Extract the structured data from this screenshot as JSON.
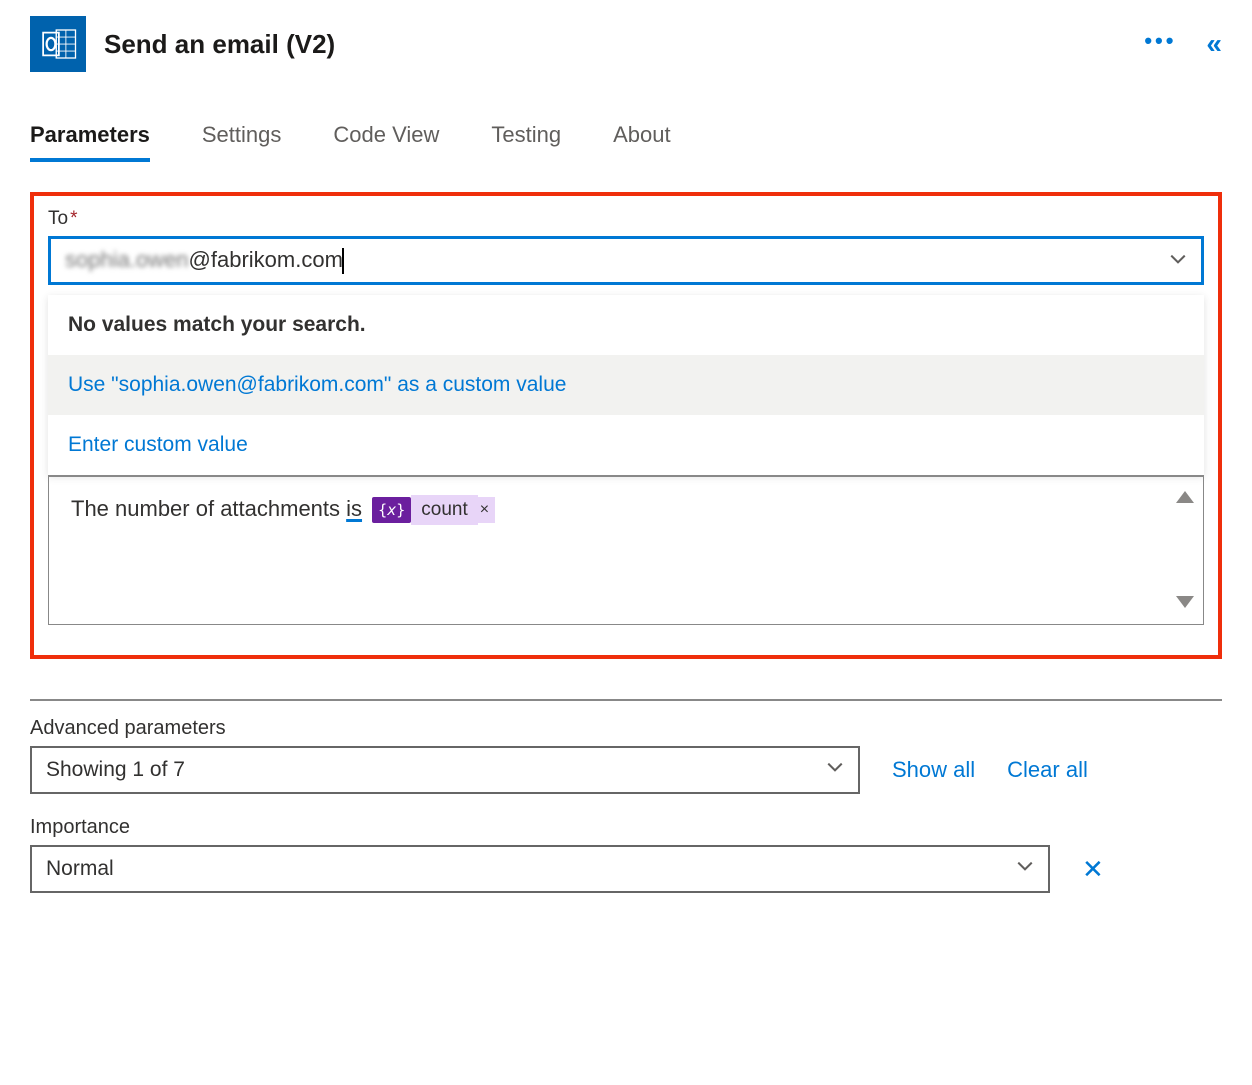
{
  "header": {
    "title": "Send an email (V2)"
  },
  "tabs": {
    "parameters": "Parameters",
    "settings": "Settings",
    "code_view": "Code View",
    "testing": "Testing",
    "about": "About"
  },
  "to_field": {
    "label": "To",
    "value_blurred": "sophia.owen",
    "value_tail": "@fabrikom.com"
  },
  "dropdown": {
    "no_match": "No values match your search.",
    "use_custom": "Use \"sophia.owen@fabrikom.com\" as a custom value",
    "enter_custom": "Enter custom value"
  },
  "body": {
    "text_part": "The number of attachments ",
    "underlined": "is",
    "token_label": "count"
  },
  "advanced": {
    "label": "Advanced parameters",
    "summary": "Showing 1 of 7",
    "show_all": "Show all",
    "clear_all": "Clear all"
  },
  "importance": {
    "label": "Importance",
    "value": "Normal"
  }
}
